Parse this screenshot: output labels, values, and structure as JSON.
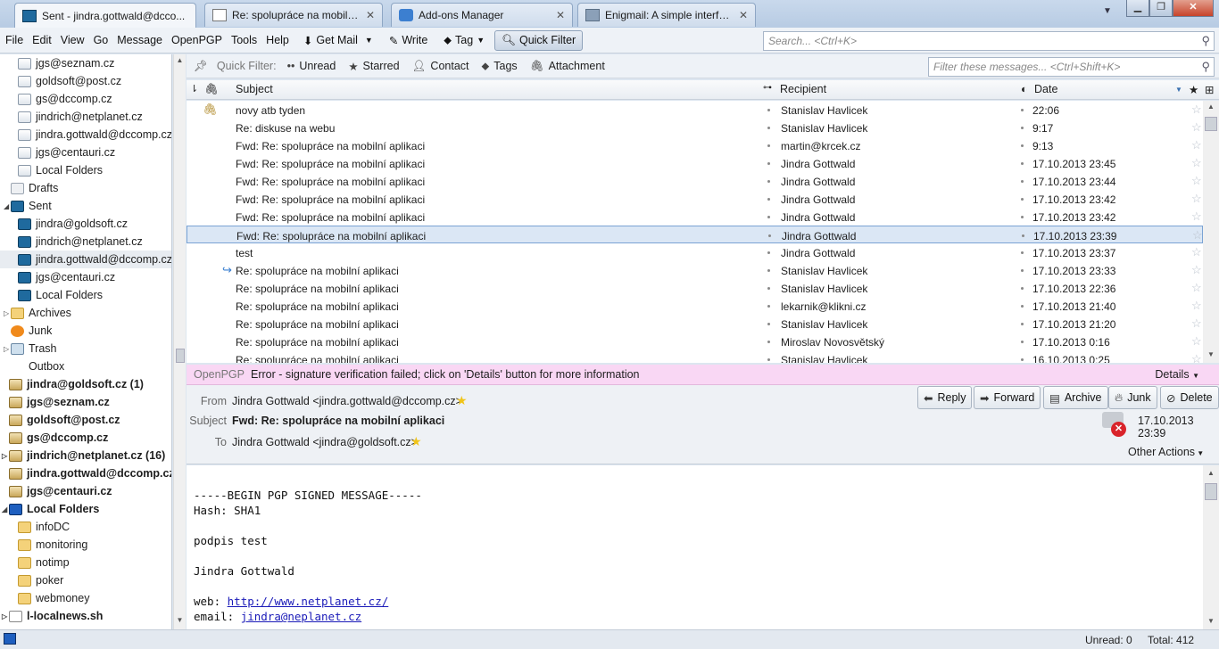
{
  "tabs": [
    {
      "label": "Sent - jindra.gottwald@dcco...",
      "icon": "mail-folder-icon"
    },
    {
      "label": "Re: spolupráce na mobilní...",
      "icon": "envelope-icon"
    },
    {
      "label": "Add-ons Manager",
      "icon": "puzzle-icon"
    },
    {
      "label": "Enigmail: A simple interfa...",
      "icon": "enigmail-icon"
    }
  ],
  "menus": [
    "File",
    "Edit",
    "View",
    "Go",
    "Message",
    "OpenPGP",
    "Tools",
    "Help"
  ],
  "toolbar": {
    "get_mail": "Get Mail",
    "write": "Write",
    "tag": "Tag",
    "quick_filter": "Quick Filter"
  },
  "search": {
    "placeholder": "Search... <Ctrl+K>"
  },
  "quickfilter": {
    "label": "Quick Filter:",
    "items": [
      "Unread",
      "Starred",
      "Contact",
      "Tags",
      "Attachment"
    ],
    "placeholder": "Filter these messages... <Ctrl+Shift+K>"
  },
  "folders": [
    {
      "label": "jgs@seznam.cz",
      "indent": 2,
      "icon": "inbox"
    },
    {
      "label": "goldsoft@post.cz",
      "indent": 2,
      "icon": "inbox"
    },
    {
      "label": "gs@dccomp.cz",
      "indent": 2,
      "icon": "inbox"
    },
    {
      "label": "jindrich@netplanet.cz",
      "indent": 2,
      "icon": "inbox"
    },
    {
      "label": "jindra.gottwald@dccomp.cz",
      "indent": 2,
      "icon": "inbox"
    },
    {
      "label": "jgs@centauri.cz",
      "indent": 2,
      "icon": "inbox"
    },
    {
      "label": "Local Folders",
      "indent": 2,
      "icon": "inbox"
    },
    {
      "label": "Drafts",
      "indent": 1,
      "icon": "drafts"
    },
    {
      "label": "Sent",
      "indent": 1,
      "icon": "sent",
      "twisty": "open"
    },
    {
      "label": "jindra@goldsoft.cz",
      "indent": 2,
      "icon": "sent"
    },
    {
      "label": "jindrich@netplanet.cz",
      "indent": 2,
      "icon": "sent"
    },
    {
      "label": "jindra.gottwald@dccomp.cz",
      "indent": 2,
      "icon": "sent",
      "selected": true
    },
    {
      "label": "jgs@centauri.cz",
      "indent": 2,
      "icon": "sent"
    },
    {
      "label": "Local Folders",
      "indent": 2,
      "icon": "sent"
    },
    {
      "label": "Archives",
      "indent": 1,
      "icon": "folder",
      "twisty": "closed"
    },
    {
      "label": "Junk",
      "indent": 1,
      "icon": "junk"
    },
    {
      "label": "Trash",
      "indent": 1,
      "icon": "trash",
      "twisty": "closed"
    },
    {
      "label": "Outbox",
      "indent": 1,
      "icon": "outbox"
    },
    {
      "label": "jindra@goldsoft.cz (1)",
      "indent": 0,
      "icon": "acct",
      "bold": true
    },
    {
      "label": "jgs@seznam.cz",
      "indent": 0,
      "icon": "acct",
      "bold": true
    },
    {
      "label": "goldsoft@post.cz",
      "indent": 0,
      "icon": "acct",
      "bold": true
    },
    {
      "label": "gs@dccomp.cz",
      "indent": 0,
      "icon": "acct",
      "bold": true
    },
    {
      "label": "jindrich@netplanet.cz (16)",
      "indent": 0,
      "icon": "acct",
      "bold": true,
      "twisty": "closed"
    },
    {
      "label": "jindra.gottwald@dccomp.cz",
      "indent": 0,
      "icon": "acct",
      "bold": true
    },
    {
      "label": "jgs@centauri.cz",
      "indent": 0,
      "icon": "acct",
      "bold": true
    },
    {
      "label": "Local Folders",
      "indent": 0,
      "icon": "pc",
      "bold": true,
      "twisty": "open"
    },
    {
      "label": "infoDC",
      "indent": 2,
      "icon": "folder"
    },
    {
      "label": "monitoring",
      "indent": 2,
      "icon": "folder"
    },
    {
      "label": "notimp",
      "indent": 2,
      "icon": "folder"
    },
    {
      "label": "poker",
      "indent": 2,
      "icon": "folder"
    },
    {
      "label": "webmoney",
      "indent": 2,
      "icon": "folder"
    },
    {
      "label": "l-localnews.sh",
      "indent": 0,
      "icon": "news",
      "bold": true,
      "twisty": "closed"
    }
  ],
  "columns": {
    "subject": "Subject",
    "recipient": "Recipient",
    "date": "Date"
  },
  "messages": [
    {
      "subject": "novy atb tyden",
      "recipient": "Stanislav Havlicek",
      "date": "22:06",
      "attach": true
    },
    {
      "subject": "Re: diskuse na webu",
      "recipient": "Stanislav Havlicek",
      "date": "9:17"
    },
    {
      "subject": "Fwd: Re: spolupráce na mobilní aplikaci",
      "recipient": "martin@krcek.cz",
      "date": "9:13"
    },
    {
      "subject": "Fwd: Re: spolupráce na mobilní aplikaci",
      "recipient": "Jindra Gottwald",
      "date": "17.10.2013 23:45"
    },
    {
      "subject": "Fwd: Re: spolupráce na mobilní aplikaci",
      "recipient": "Jindra Gottwald",
      "date": "17.10.2013 23:44"
    },
    {
      "subject": "Fwd: Re: spolupráce na mobilní aplikaci",
      "recipient": "Jindra Gottwald",
      "date": "17.10.2013 23:42"
    },
    {
      "subject": "Fwd: Re: spolupráce na mobilní aplikaci",
      "recipient": "Jindra Gottwald",
      "date": "17.10.2013 23:42"
    },
    {
      "subject": "Fwd: Re: spolupráce na mobilní aplikaci",
      "recipient": "Jindra Gottwald",
      "date": "17.10.2013 23:39",
      "selected": true
    },
    {
      "subject": "test",
      "recipient": "Jindra Gottwald",
      "date": "17.10.2013 23:37"
    },
    {
      "subject": "Re: spolupráce na mobilní aplikaci",
      "recipient": "Stanislav Havlicek",
      "date": "17.10.2013 23:33",
      "replied": true
    },
    {
      "subject": "Re: spolupráce na mobilní aplikaci",
      "recipient": "Stanislav Havlicek",
      "date": "17.10.2013 22:36"
    },
    {
      "subject": "Re: spolupráce na mobilní aplikaci",
      "recipient": "lekarnik@klikni.cz",
      "date": "17.10.2013 21:40"
    },
    {
      "subject": "Re: spolupráce na mobilní aplikaci",
      "recipient": "Stanislav Havlicek",
      "date": "17.10.2013 21:20"
    },
    {
      "subject": "Re: spolupráce na mobilní aplikaci",
      "recipient": "Miroslav Novosvětský",
      "date": "17.10.2013 0:16"
    },
    {
      "subject": "Re: spolupráce na mobilní aplikaci",
      "recipient": "Stanislav Havlicek",
      "date": "16.10.2013 0:25"
    }
  ],
  "pgp": {
    "label": "OpenPGP",
    "text": "Error - signature verification failed; click on 'Details' button for more information",
    "details": "Details"
  },
  "header": {
    "from_label": "From",
    "from": "Jindra Gottwald <jindra.gottwald@dccomp.cz>",
    "subject_label": "Subject",
    "subject": "Fwd: Re: spolupráce na mobilní aplikaci",
    "to_label": "To",
    "to": "Jindra Gottwald <jindra@goldsoft.cz>",
    "date": "17.10.2013 23:39",
    "buttons": {
      "reply": "Reply",
      "forward": "Forward",
      "archive": "Archive",
      "junk": "Junk",
      "delete": "Delete"
    },
    "other_actions": "Other Actions"
  },
  "body": [
    "-----BEGIN PGP SIGNED MESSAGE-----",
    "Hash: SHA1",
    "",
    "podpis test",
    "",
    "Jindra Gottwald",
    ""
  ],
  "body_links": {
    "web_label": "web: ",
    "web": "http://www.netplanet.cz/",
    "email_label": "email: ",
    "email": "jindra@neplanet.cz"
  },
  "status": {
    "unread": "Unread: 0",
    "total": "Total: 412"
  }
}
